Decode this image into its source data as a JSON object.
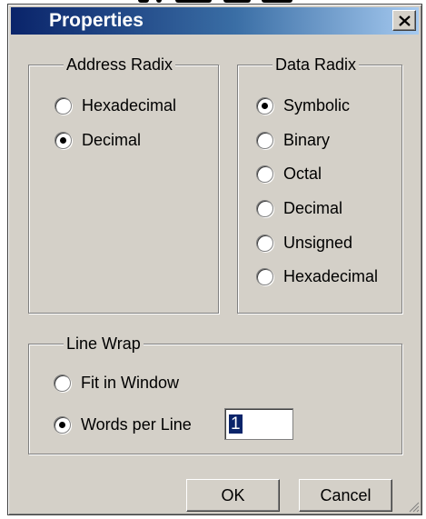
{
  "window": {
    "title": "Properties",
    "close_glyph": "✕"
  },
  "address_radix": {
    "legend": "Address Radix",
    "options": [
      {
        "label": "Hexadecimal",
        "checked": false
      },
      {
        "label": "Decimal",
        "checked": true
      }
    ]
  },
  "data_radix": {
    "legend": "Data Radix",
    "options": [
      {
        "label": "Symbolic",
        "checked": true
      },
      {
        "label": "Binary",
        "checked": false
      },
      {
        "label": "Octal",
        "checked": false
      },
      {
        "label": "Decimal",
        "checked": false
      },
      {
        "label": "Unsigned",
        "checked": false
      },
      {
        "label": "Hexadecimal",
        "checked": false
      }
    ]
  },
  "line_wrap": {
    "legend": "Line Wrap",
    "fit_label": "Fit in Window",
    "fit_checked": false,
    "words_label": "Words per Line",
    "words_checked": true,
    "words_value": "1"
  },
  "buttons": {
    "ok": "OK",
    "cancel": "Cancel"
  },
  "colors": {
    "titlebar_start": "#0a246a",
    "titlebar_end": "#a6caf0",
    "face": "#d4d0c8"
  }
}
